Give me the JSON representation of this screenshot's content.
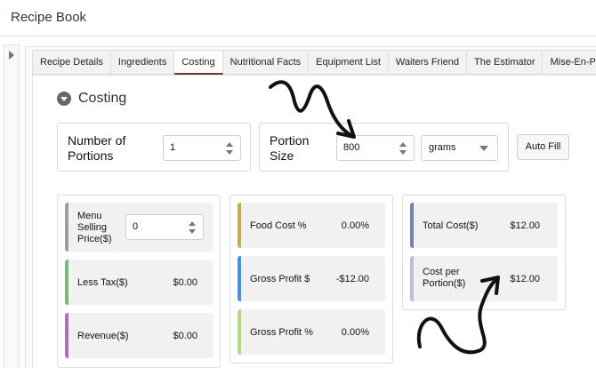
{
  "app": {
    "title": "Recipe Book"
  },
  "tabs": [
    {
      "label": "Recipe Details"
    },
    {
      "label": "Ingredients"
    },
    {
      "label": "Costing",
      "active": true
    },
    {
      "label": "Nutritional Facts"
    },
    {
      "label": "Equipment List"
    },
    {
      "label": "Waiters Friend"
    },
    {
      "label": "The Estimator"
    },
    {
      "label": "Mise-En-Pla"
    }
  ],
  "section": {
    "title": "Costing"
  },
  "portions": {
    "label": "Number of Portions",
    "value": "1"
  },
  "portion_size": {
    "label": "Portion Size",
    "value": "800",
    "unit": "grams"
  },
  "autofill": {
    "label": "Auto Fill"
  },
  "left_card": {
    "menu_price": {
      "label": "Menu Selling Price($)",
      "value": "0",
      "color": "#9e9e9e"
    },
    "less_tax": {
      "label": "Less Tax($)",
      "value": "$0.00",
      "color": "#6cc070"
    },
    "revenue": {
      "label": "Revenue($)",
      "value": "$0.00",
      "color": "#b867c6"
    }
  },
  "middle_card": {
    "food_cost": {
      "label": "Food Cost %",
      "value": "0.00%",
      "color": "#c9a85c"
    },
    "gross_profit": {
      "label": "Gross Profit $",
      "value": "-$12.00",
      "color": "#4a90d9"
    },
    "gross_profit_pct": {
      "label": "Gross Profit %",
      "value": "0.00%",
      "color": "#b5d98a"
    }
  },
  "right_card": {
    "total_cost": {
      "label": "Total Cost($)",
      "value": "$12.00",
      "color": "#7a7fa8"
    },
    "cost_per_portion": {
      "label": "Cost per Portion($)",
      "value": "$12.00",
      "color": "#c3bdd4"
    }
  },
  "icons": {
    "collapse": "chevron-down-icon",
    "sidebar": "chevron-right-icon"
  }
}
